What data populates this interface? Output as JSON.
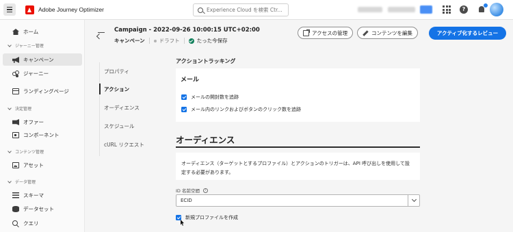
{
  "topbar": {
    "app_title": "Adobe Journey Optimizer",
    "search_placeholder": "Experience Cloud を検索 Ctr...",
    "org_label": "CJM Stage",
    "sandbox_label": "Prod (VA7)",
    "prod_badge": "Prod"
  },
  "leftnav": {
    "home": "ホーム",
    "sec_journey": "ジャーニー管理",
    "campaigns": "キャンペーン",
    "journeys": "ジャーニー",
    "landing_pages": "ランディングページ",
    "sec_decision": "決定管理",
    "offers": "オファー",
    "components": "コンポーネント",
    "sec_content": "コンテンツ管理",
    "assets": "アセット",
    "sec_data": "データ管理",
    "schemas": "スキーマ",
    "datasets": "データセット",
    "queries": "クエリ"
  },
  "header": {
    "title": "Campaign - 2022-09-26 10:00:15 UTC+02:00",
    "type": "キャンペーン",
    "status": "ドラフト",
    "saved": "たった今保存",
    "access_button": "アクセスの管理",
    "edit_button": "コンテンツを編集",
    "activate_button": "アクティブ化するレビュー"
  },
  "subnav": {
    "items": [
      "プロパティ",
      "アクション",
      "オーディエンス",
      "スケジュール",
      "cURL リクエスト"
    ],
    "active_index": 1
  },
  "content": {
    "tracking_heading": "アクショントラッキング",
    "email_title": "メール",
    "track_opens": "メールの開封数を追跡",
    "track_clicks": "メール内のリンクおよびボタンのクリック数を追跡",
    "audience_title": "オーディエンス",
    "audience_desc": "オーディエンス（ターゲットとするプロファイル）とアクションのトリガーは、API 呼び出しを使用して設定する必要があります。",
    "id_namespace_label": "ID 名前空間",
    "id_namespace_value": "ECID",
    "create_profile_label": "新規プロファイルを作成"
  },
  "colors": {
    "accent": "#1473e6",
    "adobe_red": "#eb1000",
    "saved_green": "#12805c"
  }
}
